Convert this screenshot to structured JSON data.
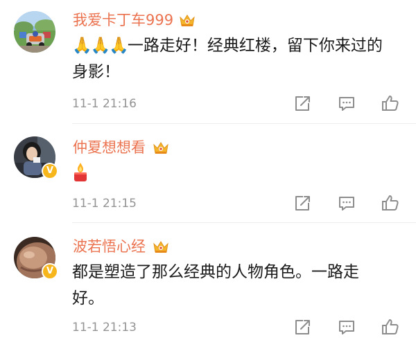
{
  "comments": [
    {
      "username": "我爱卡丁车999",
      "emoji": "🙏🙏🙏",
      "text_line1": "一路走好！经典红楼，留下你来过的",
      "text_line2": "身影！",
      "time": "11-1 21:16",
      "verified": false
    },
    {
      "username": "仲夏想想看",
      "time": "11-1 21:15",
      "verified": true
    },
    {
      "username": "波若悟心经",
      "text_line1": "都是塑造了那么经典的人物角色。一路走",
      "text_line2": "好。",
      "time": "11-1 21:13",
      "verified": true
    }
  ],
  "icons": {
    "share": "share-icon",
    "comment": "comment-icon",
    "like": "thumbs-up-icon",
    "crown": "crown-badge-icon",
    "verified": "verified-badge-icon",
    "candle": "candle-emoji-icon"
  },
  "colors": {
    "username": "#eb7350",
    "text": "#1a1a1a",
    "meta": "#939393",
    "divider": "#ececec",
    "badge": "#f7b61c"
  }
}
